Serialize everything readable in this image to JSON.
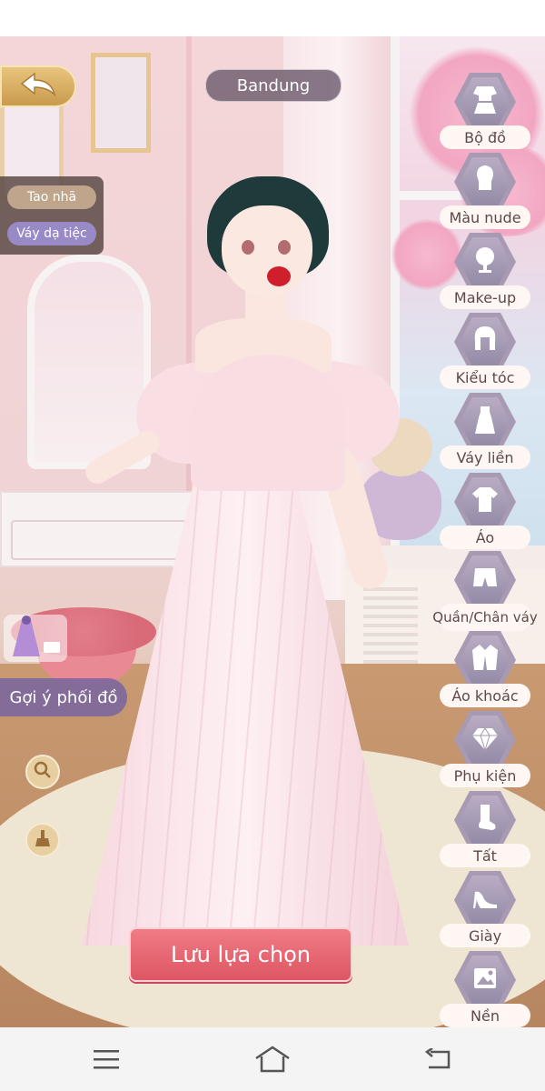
{
  "header": {
    "character_name": "Bandung"
  },
  "style_tags": [
    "Tao nhã",
    "Váy dạ tiệc"
  ],
  "left_tools": {
    "suggest_label": "Gợi ý phối đồ",
    "zoom_icon": "magnifier-icon",
    "clean_icon": "broom-icon"
  },
  "save_button": {
    "label": "Lưu lựa chọn"
  },
  "categories": [
    {
      "label": "Bộ đồ",
      "icon": "outfit-set-icon"
    },
    {
      "label": "Màu nude",
      "icon": "nude-head-icon"
    },
    {
      "label": "Make-up",
      "icon": "mirror-icon"
    },
    {
      "label": "Kiểu tóc",
      "icon": "hairstyle-icon"
    },
    {
      "label": "Váy liền",
      "icon": "dress-icon"
    },
    {
      "label": "Áo",
      "icon": "shirt-icon"
    },
    {
      "label": "Quần/Chân váy",
      "icon": "shorts-icon"
    },
    {
      "label": "Áo khoác",
      "icon": "jacket-icon"
    },
    {
      "label": "Phụ kiện",
      "icon": "diamond-icon"
    },
    {
      "label": "Tất",
      "icon": "sock-icon"
    },
    {
      "label": "Giày",
      "icon": "high-heel-icon"
    },
    {
      "label": "Nền",
      "icon": "background-image-icon"
    }
  ],
  "colors": {
    "accent_save": "#dd5663",
    "category_hex": "#a79ab2",
    "back_gold": "#c99b4e"
  },
  "system_nav": [
    "menu-icon",
    "home-icon",
    "back-icon"
  ]
}
